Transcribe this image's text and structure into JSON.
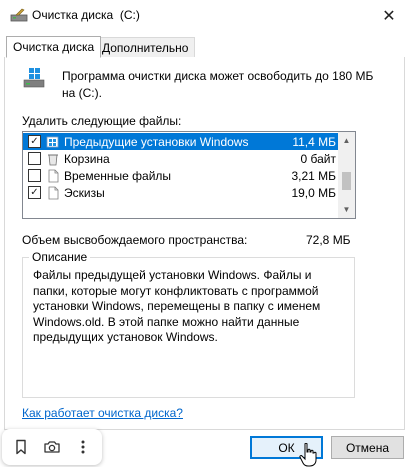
{
  "window": {
    "title": "Очистка диска  (C:)"
  },
  "tabs": [
    {
      "label": "Очистка диска",
      "active": true
    },
    {
      "label": "Дополнительно",
      "active": false
    }
  ],
  "summary": {
    "text": "Программа очистки диска может освободить до 180 МБ на  (C:)."
  },
  "files": {
    "label": "Удалить следующие файлы:",
    "items": [
      {
        "name": "Предыдущие установки Windows",
        "size": "11,4 МБ",
        "checked": true,
        "selected": true,
        "icon": "windows-update-icon"
      },
      {
        "name": "Корзина",
        "size": "0 байт",
        "checked": false,
        "selected": false,
        "icon": "recycle-bin-icon"
      },
      {
        "name": "Временные файлы",
        "size": "3,21 МБ",
        "checked": false,
        "selected": false,
        "icon": "file-icon"
      },
      {
        "name": "Эскизы",
        "size": "19,0 МБ",
        "checked": true,
        "selected": false,
        "icon": "file-icon"
      }
    ]
  },
  "total": {
    "label": "Объем высвобождаемого пространства:",
    "value": "72,8 МБ"
  },
  "description": {
    "title": "Описание",
    "text": "Файлы предыдущей установки Windows.  Файлы и папки, которые могут конфликтовать с программой установки Windows, перемещены в папку с именем Windows.old.  В этой папке можно найти данные предыдущих установок Windows."
  },
  "help_link": "Как работает очистка диска?",
  "buttons": {
    "ok": "ОК",
    "cancel": "Отмена"
  },
  "colors": {
    "accent": "#0078d7",
    "link": "#0066cc"
  }
}
